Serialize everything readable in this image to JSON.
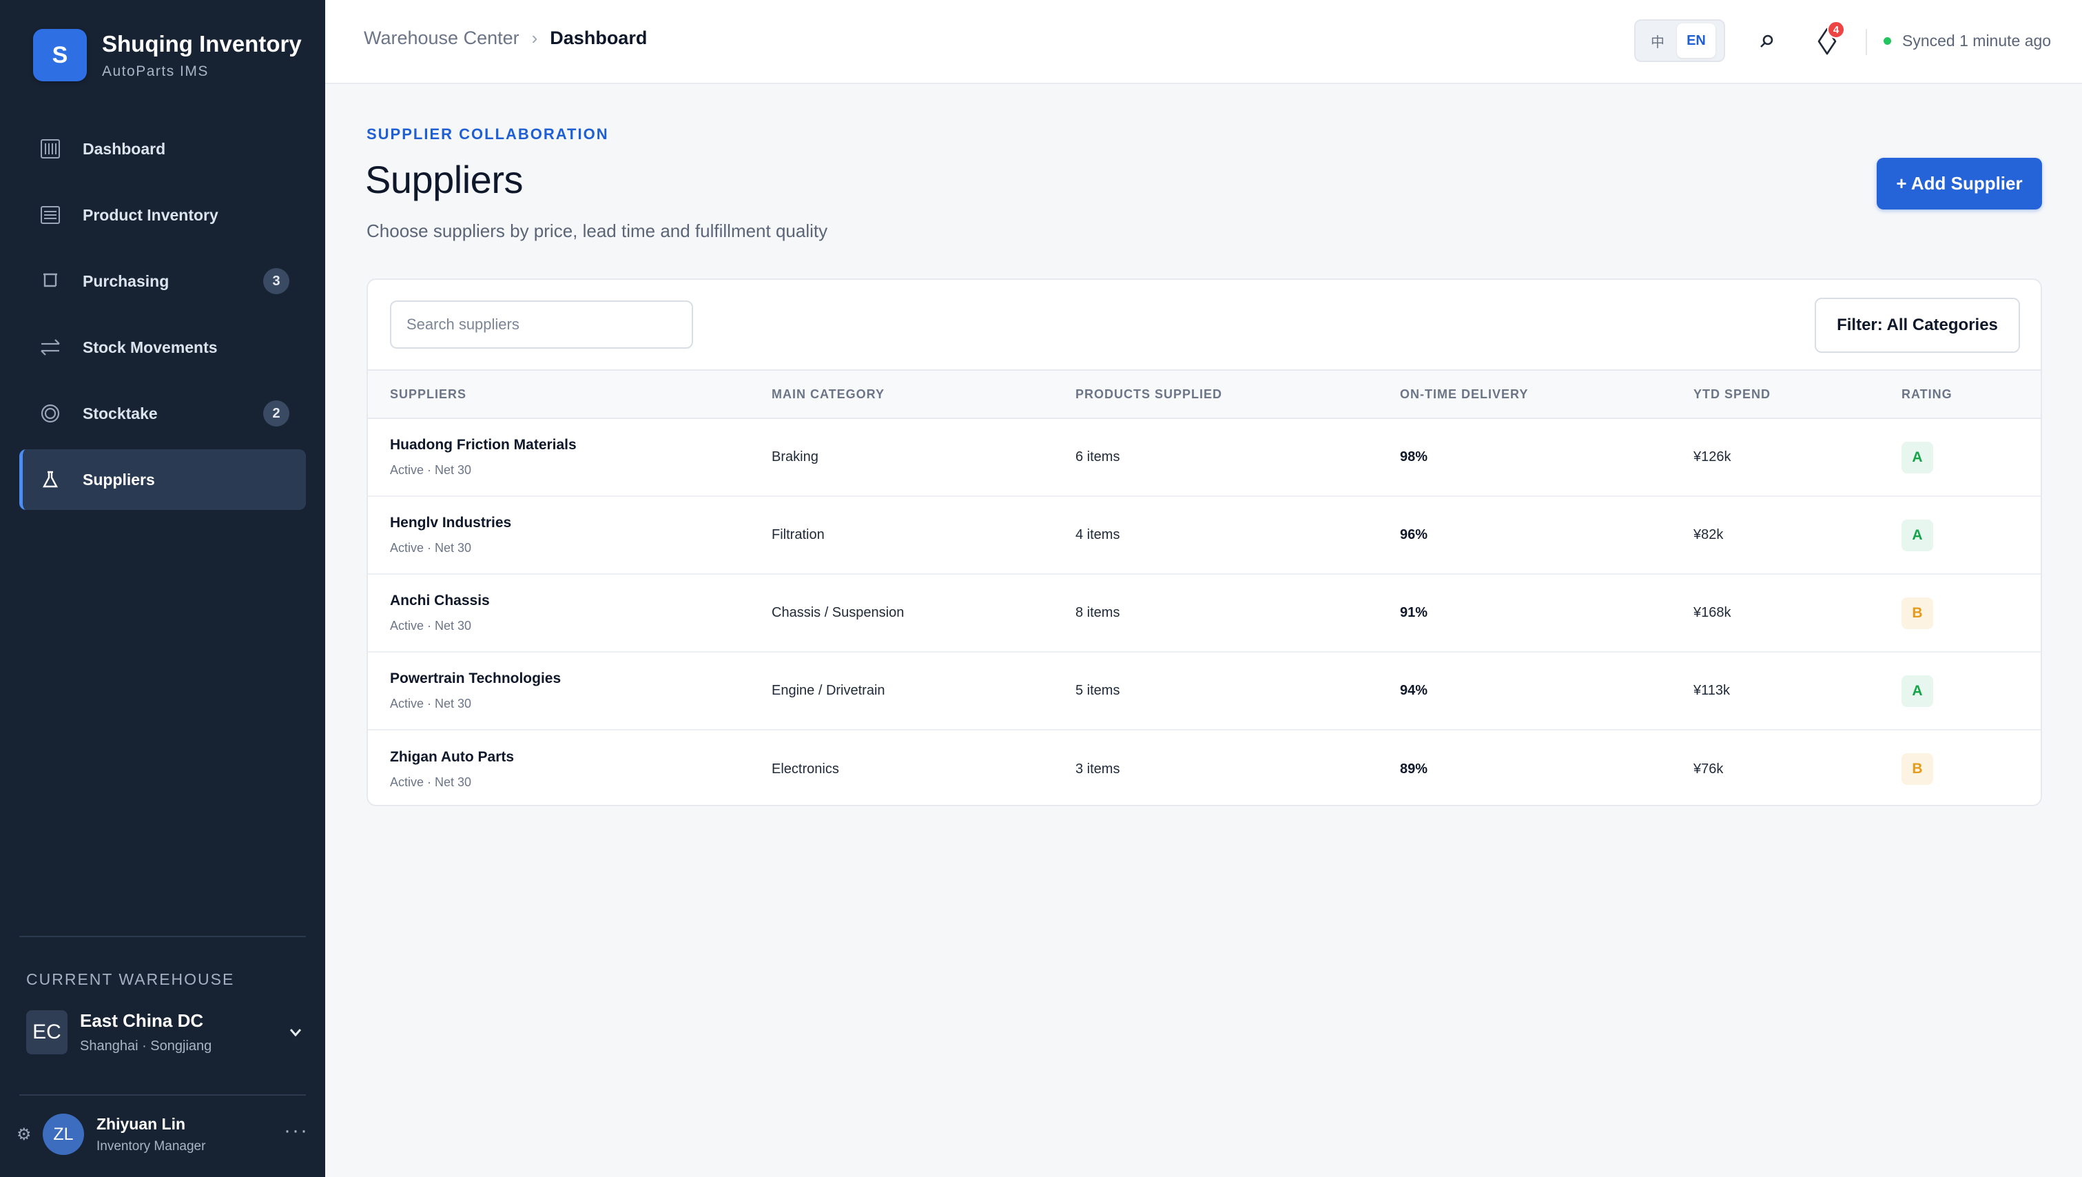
{
  "brand": {
    "logo_letter": "S",
    "title": "Shuqing Inventory",
    "subtitle": "AutoParts IMS"
  },
  "sidebar": {
    "items": [
      {
        "label": "Dashboard",
        "icon": "grid-icon",
        "badge": ""
      },
      {
        "label": "Product Inventory",
        "icon": "box-icon",
        "badge": ""
      },
      {
        "label": "Purchasing",
        "icon": "cart-icon",
        "badge": "3"
      },
      {
        "label": "Stock Movements",
        "icon": "transfer-icon",
        "badge": ""
      },
      {
        "label": "Stocktake",
        "icon": "target-icon",
        "badge": "2"
      },
      {
        "label": "Suppliers",
        "icon": "flask-icon",
        "badge": "",
        "active": true
      }
    ],
    "warehouse": {
      "caption": "CURRENT WAREHOUSE",
      "initials": "EC",
      "name": "East China DC",
      "location": "Shanghai · Songjiang"
    },
    "user": {
      "initials": "ZL",
      "name": "Zhiyuan Lin",
      "role": "Inventory Manager"
    }
  },
  "topbar": {
    "breadcrumb_parent": "Warehouse Center",
    "breadcrumb_current": "Dashboard",
    "lang_zh": "中",
    "lang_en": "EN",
    "notification_count": "4",
    "sync_status": "Synced 1 minute ago"
  },
  "main": {
    "eyebrow": "SUPPLIER COLLABORATION",
    "title": "Suppliers",
    "description": "Choose suppliers by price, lead time and fulfillment quality",
    "add_button": "+ Add Supplier",
    "search_placeholder": "Search suppliers",
    "filter_button": "Filter: All Categories",
    "columns": [
      "SUPPLIERS",
      "MAIN CATEGORY",
      "PRODUCTS SUPPLIED",
      "ON-TIME DELIVERY",
      "YTD SPEND",
      "RATING"
    ],
    "rows": [
      {
        "name": "Huadong Friction Materials",
        "meta": "Active · Net 30",
        "category": "Braking",
        "products": "6 items",
        "ontime": "98%",
        "spend": "¥126k",
        "rating": "A"
      },
      {
        "name": "Henglv Industries",
        "meta": "Active · Net 30",
        "category": "Filtration",
        "products": "4 items",
        "ontime": "96%",
        "spend": "¥82k",
        "rating": "A"
      },
      {
        "name": "Anchi Chassis",
        "meta": "Active · Net 30",
        "category": "Chassis / Suspension",
        "products": "8 items",
        "ontime": "91%",
        "spend": "¥168k",
        "rating": "B"
      },
      {
        "name": "Powertrain Technologies",
        "meta": "Active · Net 30",
        "category": "Engine / Drivetrain",
        "products": "5 items",
        "ontime": "94%",
        "spend": "¥113k",
        "rating": "A"
      },
      {
        "name": "Zhigan Auto Parts",
        "meta": "Active · Net 30",
        "category": "Electronics",
        "products": "3 items",
        "ontime": "89%",
        "spend": "¥76k",
        "rating": "B"
      }
    ]
  },
  "colors": {
    "sidebar_bg": "#172233",
    "accent": "#2463d8",
    "rating_a": "#16a34a",
    "rating_b": "#e59a1a",
    "notification": "#ef4444",
    "sync_ok": "#22c55e"
  }
}
